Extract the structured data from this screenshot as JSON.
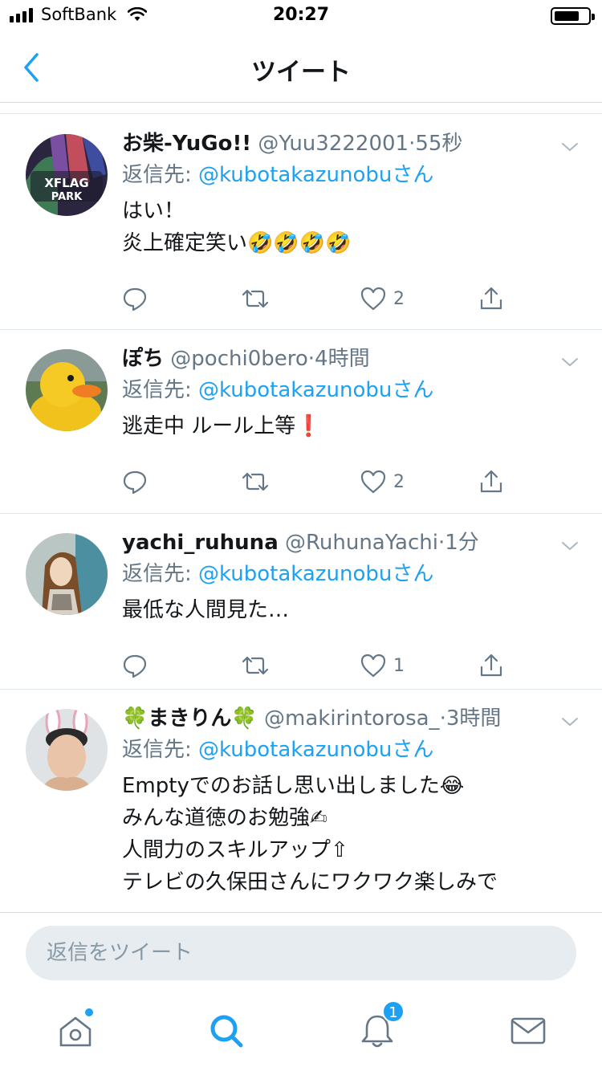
{
  "status_bar": {
    "carrier": "SoftBank",
    "time": "20:27",
    "signal_icon": "signal-bars-icon",
    "wifi_icon": "wifi-icon",
    "battery_icon": "battery-icon"
  },
  "nav": {
    "title": "ツイート",
    "back_icon": "chevron-left-icon"
  },
  "tweets": [
    {
      "display_name": "お柴-YuGo!!",
      "handle": "@Yuu3222001",
      "dot": "·",
      "time": "55秒",
      "reply_prefix": "返信先: ",
      "reply_mention": "@kubotakazunobuさん",
      "text": "はい！\n炎上確定笑い🤣🤣🤣🤣",
      "likes": "2"
    },
    {
      "display_name": "ぽち",
      "handle": "@pochi0bero",
      "dot": "·",
      "time": "4時間",
      "reply_prefix": "返信先: ",
      "reply_mention": "@kubotakazunobuさん",
      "text": "逃走中 ルール上等❗",
      "likes": "2"
    },
    {
      "display_name": "yachi_ruhuna",
      "handle": "@RuhunaYachi",
      "dot": "·",
      "time": "1分",
      "reply_prefix": "返信先: ",
      "reply_mention": "@kubotakazunobuさん",
      "text": "最低な人間見た…",
      "likes": "1"
    },
    {
      "display_name": "🍀まきりん🍀",
      "handle": "@makirintorosa_",
      "dot": "·",
      "time": "3時間",
      "reply_prefix": "返信先: ",
      "reply_mention": "@kubotakazunobuさん",
      "text": "Emptyでのお話し思い出しました😂\nみんな道徳のお勉強✍\n人間力のスキルアップ⇧\nテレビの久保田さんにワクワク楽しみで",
      "likes": ""
    }
  ],
  "reply_bar": {
    "placeholder": "返信をツイート"
  },
  "tab_bar": {
    "notifications_badge": "1",
    "tabs": [
      "home-icon",
      "search-icon",
      "bell-icon",
      "mail-icon"
    ]
  },
  "colors": {
    "accent": "#1da1f2",
    "secondary_text": "#657786",
    "primary_text": "#14171a",
    "divider": "#e1e8ed"
  }
}
